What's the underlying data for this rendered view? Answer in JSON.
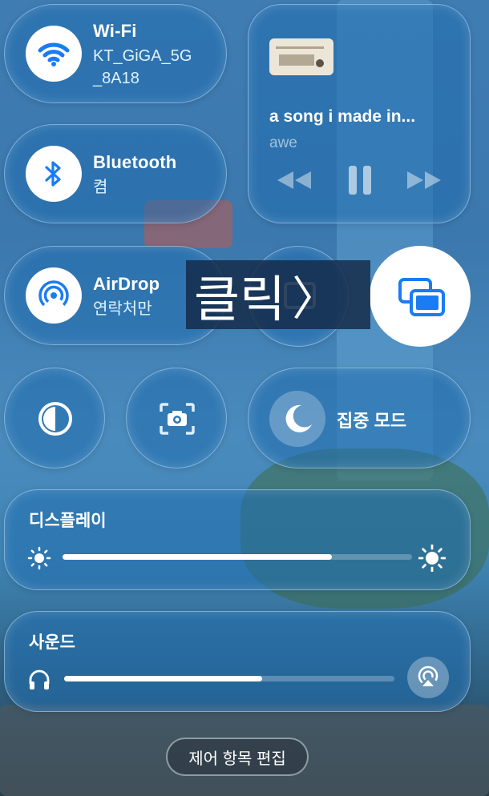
{
  "wifi": {
    "title": "Wi-Fi",
    "network_line1": "KT_GiGA_5G",
    "network_line2": "_8A18"
  },
  "bluetooth": {
    "title": "Bluetooth",
    "status": "켬"
  },
  "airdrop": {
    "title": "AirDrop",
    "status": "연락처만"
  },
  "now_playing": {
    "title": "a song i made in...",
    "artist": "awe"
  },
  "click_banner": {
    "label": "클릭",
    "arrow": "〉"
  },
  "focus": {
    "label": "집중 모드"
  },
  "display": {
    "label": "디스플레이",
    "brightness": 0.77
  },
  "sound": {
    "label": "사운드",
    "volume": 0.6
  },
  "edit_button": {
    "label": "제어 항목 편집"
  },
  "colors": {
    "accent": "#1a7cf5",
    "tile_bg": "#206eaf"
  }
}
